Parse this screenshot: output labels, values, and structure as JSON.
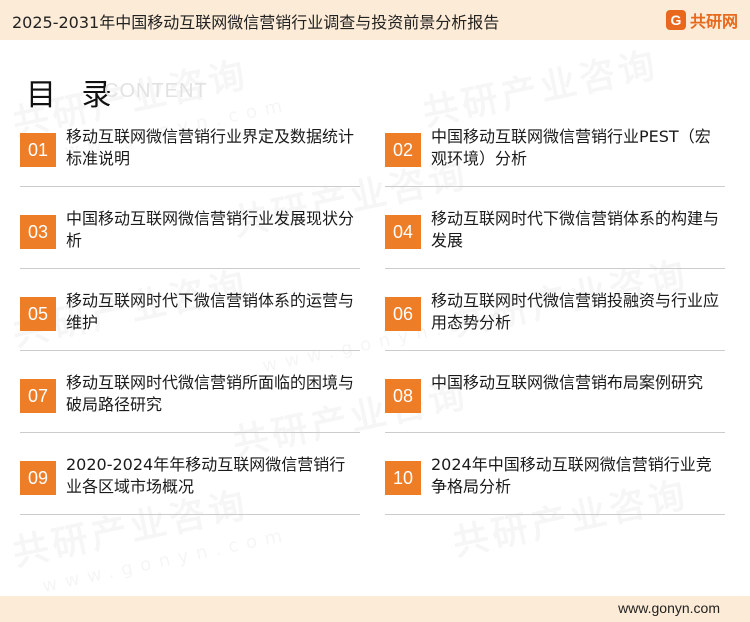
{
  "header": {
    "title": "2025-2031年中国移动互联网微信营销行业调查与投资前景分析报告",
    "logo_text": "共研网",
    "logo_icon": "gonyn-logo-icon"
  },
  "toc": {
    "title": "目 录",
    "subtitle": "CONTENT",
    "accent_color": "#ee7d28",
    "items": [
      {
        "num": "01",
        "label": "移动互联网微信营销行业界定及数据统计标准说明"
      },
      {
        "num": "02",
        "label": "中国移动互联网微信营销行业PEST（宏观环境）分析"
      },
      {
        "num": "03",
        "label": "中国移动互联网微信营销行业发展现状分析"
      },
      {
        "num": "04",
        "label": "移动互联网时代下微信营销体系的构建与发展"
      },
      {
        "num": "05",
        "label": "移动互联网时代下微信营销体系的运营与维护"
      },
      {
        "num": "06",
        "label": "移动互联网时代微信营销投融资与行业应用态势分析"
      },
      {
        "num": "07",
        "label": "移动互联网时代微信营销所面临的困境与破局路径研究"
      },
      {
        "num": "08",
        "label": "中国移动互联网微信营销布局案例研究"
      },
      {
        "num": "09",
        "label": "2020-2024年年移动互联网微信营销行业各区域市场概况"
      },
      {
        "num": "10",
        "label": "2024年中国移动互联网微信营销行业竞争格局分析"
      }
    ]
  },
  "watermark": {
    "text": "共研产业咨询",
    "url": "www.gonyn.com"
  },
  "footer": {
    "url": "www.gonyn.com"
  }
}
